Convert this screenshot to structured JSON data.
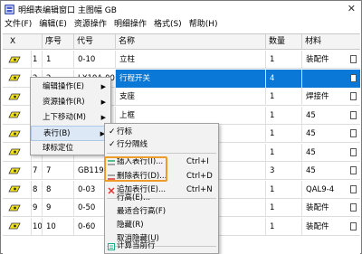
{
  "window": {
    "title": "明细表编辑窗口 主图幅 GB",
    "close_glyph": "✕"
  },
  "menubar": [
    "文件(F)",
    "编辑(E)",
    "资源操作",
    "明细操作",
    "格式(S)",
    "帮助(H)"
  ],
  "table": {
    "headers": {
      "first": "X",
      "seq": "序号",
      "code": "代号",
      "name": "名称",
      "qty": "数量",
      "material": "材料"
    },
    "rows": [
      {
        "idx": "1",
        "seq": "1",
        "code": "0-10",
        "name": "立柱",
        "qty": "1",
        "material": "装配件"
      },
      {
        "idx": "2",
        "seq": "2",
        "code": "LX19A-001",
        "name": "行程开关",
        "qty": "4",
        "material": ""
      },
      {
        "idx": "3",
        "seq": "",
        "code": "",
        "name": "支座",
        "qty": "1",
        "material": "焊接件"
      },
      {
        "idx": "4",
        "seq": "",
        "code": "",
        "name": "上框",
        "qty": "1",
        "material": "45"
      },
      {
        "idx": "5",
        "seq": "",
        "code": "",
        "name": "",
        "qty": "1",
        "material": "45"
      },
      {
        "idx": "6",
        "seq": "",
        "code": "",
        "name": "",
        "qty": "1",
        "material": "45"
      },
      {
        "idx": "7",
        "seq": "7",
        "code": "GB119-8",
        "name": "",
        "qty": "3",
        "material": "45"
      },
      {
        "idx": "8",
        "seq": "8",
        "code": "0-03",
        "name": "",
        "qty": "1",
        "material": "QAL9-4"
      },
      {
        "idx": "9",
        "seq": "9",
        "code": "0-50",
        "name": "",
        "qty": "1",
        "material": "装配件"
      },
      {
        "idx": "10",
        "seq": "10",
        "code": "0-60",
        "name": "",
        "qty": "1",
        "material": "装配件"
      }
    ],
    "selected_row": 2
  },
  "context_menu": {
    "items": [
      "编辑操作(E)",
      "资源操作(R)",
      "上下移动(M)",
      "表行(B)",
      "球标定位"
    ]
  },
  "submenu": {
    "items": {
      "hangbiao": "行标",
      "hangfenge": "行分隔线",
      "insert": "插入表行(I)...",
      "insert_sc": "Ctrl+I",
      "delete": "删除表行(D)...",
      "delete_sc": "Ctrl+D",
      "append": "追加表行(E)...",
      "append_sc": "Ctrl+N",
      "height": "行高(E)...",
      "best_height": "最适合行高(F)",
      "hide": "隐藏(R)",
      "unhide": "取消隐藏(U)",
      "calc": "计算当前行"
    }
  }
}
